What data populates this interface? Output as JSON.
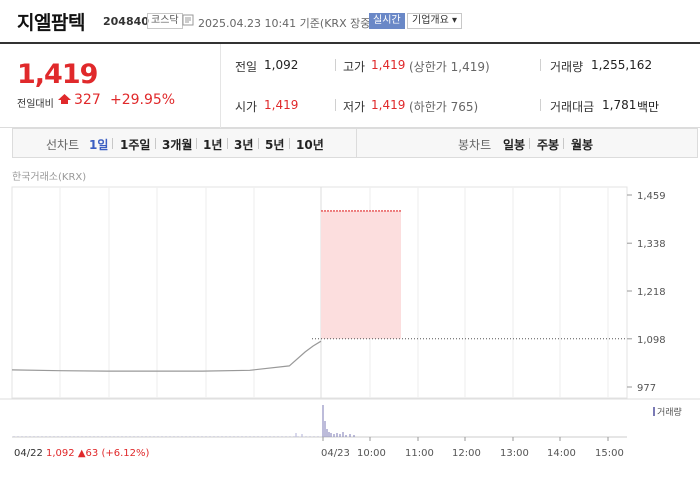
{
  "header": {
    "name": "지엘팜텍",
    "code": "204840",
    "market": "코스닥",
    "time": "2025.04.23 10:41  기준(KRX 장중)",
    "realtime_label": "실시간",
    "corp_label": "기업개요 ▾"
  },
  "price": {
    "current": "1,419",
    "change_label": "전일대비",
    "change": "327",
    "change_pct": "+29.95%",
    "color_up": "#e0292b"
  },
  "summary": {
    "prev_close_label": "전일",
    "prev_close": "1,092",
    "open_label": "시가",
    "open": "1,419",
    "high_label": "고가",
    "high": "1,419",
    "high_note": "(상한가 1,419)",
    "low_label": "저가",
    "low": "1,419",
    "low_note": "(하한가 765)",
    "volume_label": "거래량",
    "volume": "1,255,162",
    "amount_label": "거래대금",
    "amount": "1,781",
    "amount_unit": "백만"
  },
  "period_bar": {
    "line_label": "선차트",
    "line_items": [
      "1일",
      "1주일",
      "3개월",
      "1년",
      "3년",
      "5년",
      "10년"
    ],
    "selected": "1일",
    "candle_label": "봉차트",
    "candle_items": [
      "일봉",
      "주봉",
      "월봉"
    ]
  },
  "source_label": "한국거래소(KRX)",
  "chart_data": {
    "type": "line",
    "title": "",
    "y_ticks": [
      "1,459",
      "1,338",
      "1,218",
      "1,098",
      "977"
    ],
    "ylim": [
      977,
      1459
    ],
    "x_ticks": [
      "04/23",
      "10:00",
      "11:00",
      "12:00",
      "13:00",
      "14:00",
      "15:00"
    ],
    "reference_line": 1098,
    "upper_band": 1419,
    "previous_day": {
      "label": "04/22",
      "close": "1,092",
      "change": "63",
      "change_pct": "(+6.12%)"
    },
    "price_series": [
      {
        "x": "04/22 09:00",
        "y": 1020
      },
      {
        "x": "04/22 10:00",
        "y": 1018
      },
      {
        "x": "04/22 11:00",
        "y": 1017
      },
      {
        "x": "04/22 12:00",
        "y": 1017
      },
      {
        "x": "04/22 13:00",
        "y": 1017
      },
      {
        "x": "04/22 14:00",
        "y": 1019
      },
      {
        "x": "04/22 14:50",
        "y": 1030
      },
      {
        "x": "04/22 15:10",
        "y": 1065
      },
      {
        "x": "04/22 15:20",
        "y": 1080
      },
      {
        "x": "04/22 15:30",
        "y": 1092
      },
      {
        "x": "04/23 09:00",
        "y": 1419
      },
      {
        "x": "04/23 10:41",
        "y": 1419
      }
    ],
    "volume_label": "거래량",
    "colors": {
      "line": "#999999",
      "band_fill": "#fcdede",
      "band_edge": "#e0292b",
      "volume": "#7b7ab5"
    }
  }
}
